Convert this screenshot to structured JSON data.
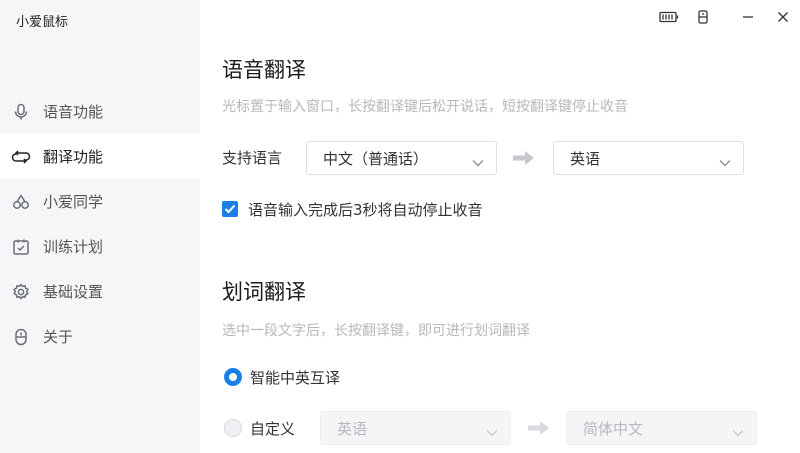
{
  "app": {
    "title": "小爱鼠标"
  },
  "sidebar": {
    "items": [
      {
        "label": "语音功能",
        "icon": "microphone-icon"
      },
      {
        "label": "翻译功能",
        "icon": "translate-icon",
        "active": true
      },
      {
        "label": "小爱同学",
        "icon": "xiaoai-icon"
      },
      {
        "label": "训练计划",
        "icon": "calendar-check-icon"
      },
      {
        "label": "基础设置",
        "icon": "gear-icon"
      },
      {
        "label": "关于",
        "icon": "mouse-icon"
      }
    ]
  },
  "titlebar": {
    "icons": [
      "battery-icon",
      "device-icon",
      "minimize-icon",
      "close-icon"
    ]
  },
  "voice_translation": {
    "title": "语音翻译",
    "hint": "光标置于输入窗口，长按翻译键后松开说话，短按翻译键停止收音",
    "support_label": "支持语言",
    "source_language": "中文（普通话）",
    "target_language": "英语",
    "auto_stop_label": "语音输入完成后3秒将自动停止收音",
    "auto_stop_checked": true
  },
  "word_translation": {
    "title": "划词翻译",
    "hint": "选中一段文字后，长按翻译键，即可进行划词翻译",
    "smart_label": "智能中英互译",
    "custom_label": "自定义",
    "custom_source": "英语",
    "custom_target": "简体中文",
    "selected_mode": "smart"
  },
  "colors": {
    "accent": "#1a7fe6",
    "sidebar_bg": "#f5f6f8",
    "hint": "#b5b8bd"
  }
}
